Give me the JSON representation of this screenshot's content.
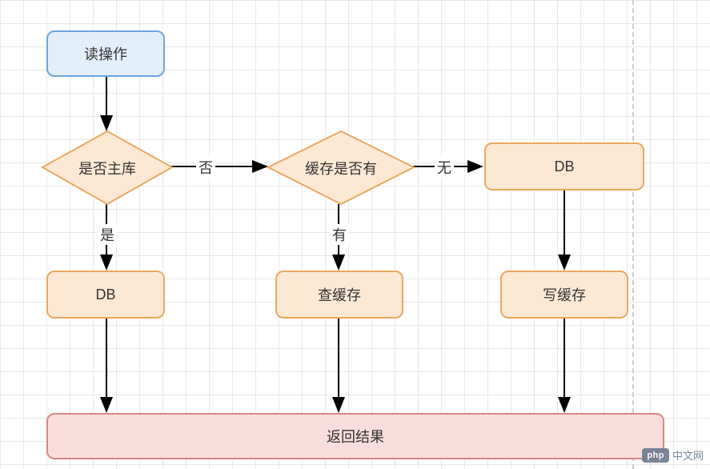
{
  "chart_data": {
    "type": "flowchart",
    "nodes": [
      {
        "id": "start",
        "type": "start",
        "label": "读操作"
      },
      {
        "id": "d1",
        "type": "decision",
        "label": "是否主库"
      },
      {
        "id": "d2",
        "type": "decision",
        "label": "缓存是否有"
      },
      {
        "id": "p_db_top",
        "type": "process",
        "label": "DB"
      },
      {
        "id": "p_db_left",
        "type": "process",
        "label": "DB"
      },
      {
        "id": "p_query_cache",
        "type": "process",
        "label": "查缓存"
      },
      {
        "id": "p_write_cache",
        "type": "process",
        "label": "写缓存"
      },
      {
        "id": "result",
        "type": "result",
        "label": "返回结果"
      }
    ],
    "edges": [
      {
        "from": "start",
        "to": "d1",
        "label": ""
      },
      {
        "from": "d1",
        "to": "d2",
        "label": "否"
      },
      {
        "from": "d1",
        "to": "p_db_left",
        "label": "是"
      },
      {
        "from": "d2",
        "to": "p_query_cache",
        "label": "有"
      },
      {
        "from": "d2",
        "to": "p_db_top",
        "label": "无"
      },
      {
        "from": "p_db_top",
        "to": "p_write_cache",
        "label": ""
      },
      {
        "from": "p_db_left",
        "to": "result",
        "label": ""
      },
      {
        "from": "p_query_cache",
        "to": "result",
        "label": ""
      },
      {
        "from": "p_write_cache",
        "to": "result",
        "label": ""
      }
    ]
  },
  "nodes": {
    "start": "读操作",
    "d1": "是否主库",
    "d2": "缓存是否有",
    "db_top": "DB",
    "db_left": "DB",
    "query_cache": "查缓存",
    "write_cache": "写缓存",
    "result": "返回结果"
  },
  "edge_labels": {
    "no": "否",
    "yes": "是",
    "has": "有",
    "none": "无"
  },
  "watermark": {
    "badge": "php",
    "text": "中文网"
  }
}
